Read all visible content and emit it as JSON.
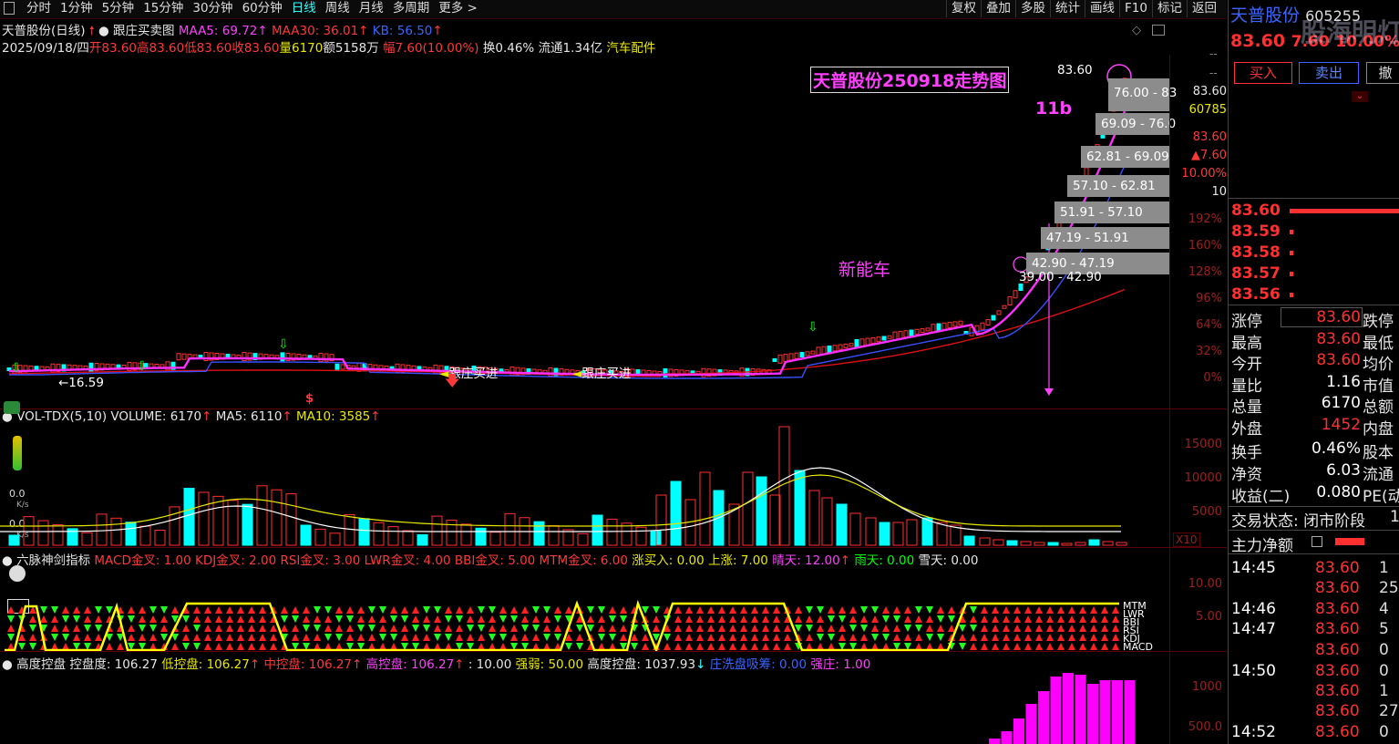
{
  "toolbar": {
    "tabs": [
      "分时",
      "1分钟",
      "5分钟",
      "15分钟",
      "30分钟",
      "60分钟",
      "日线",
      "周线",
      "月线",
      "多周期",
      "更多 >"
    ],
    "tools": [
      "复权",
      "叠加",
      "多股",
      "统计",
      "画线",
      "F10",
      "标记",
      "返回"
    ]
  },
  "header": {
    "name_line": "天普股份(日线)",
    "indicator": "跟庄买卖图",
    "maa5": "MAA5: 69.72",
    "maa30": "MAA30: 36.01",
    "kb": "KB: 56.50",
    "date": "2025/09/18/四",
    "open": "开83.60",
    "high": "高83.60",
    "low": "低83.60",
    "close": "收83.60",
    "vol": "量6170",
    "amount": "额5158万",
    "change": "幅7.60(10.00%)",
    "turnover": "换0.46%",
    "float": "流通1.34亿",
    "sector": "汽车配件"
  },
  "chart": {
    "title_box": "天普股份250918走势图",
    "label_11b": "11b",
    "label_xny": "新能车",
    "last_price_tag": "83.60",
    "low_tag": "←16.59",
    "signal_buy": "跟庄买进",
    "dollar_mark": "$",
    "right_axis": [
      "83.60",
      "60785",
      "83.60",
      "▲7.60",
      "10.00%",
      "10"
    ],
    "pct_axis": [
      "192%",
      "160%",
      "128%",
      "96%",
      "64%",
      "32%",
      "0%"
    ],
    "dashes": [
      "--",
      "--"
    ],
    "ladder": [
      "76.00 - 83",
      "69.09 - 76.0",
      "62.81 - 69.09",
      "57.10 - 62.81",
      "51.91 - 57.10",
      "47.19 - 51.91",
      "42.90 - 47.19",
      "39.00 - 42.90"
    ]
  },
  "volume_panel": {
    "title": "VOL-TDX(5,10) VOLUME: 6170",
    "ma5": "MA5: 6110",
    "ma10": "MA10: 3585",
    "axis": [
      "15000",
      "10000",
      "5000"
    ],
    "x10": "X10",
    "side_vals": [
      "0.0",
      "K/s",
      "0.0",
      "K/s"
    ]
  },
  "sword_panel": {
    "title": "六脉神剑指标",
    "macd": "MACD金叉: 1.00",
    "kdj": "KDJ金叉: 2.00",
    "rsi": "RSI金叉: 3.00",
    "lwr": "LWR金叉: 4.00",
    "bbi": "BBI金叉: 5.00",
    "mtm": "MTM金叉: 6.00",
    "zmr": "涨买入: 0.00",
    "up": "上涨: 7.00",
    "sunny": "晴天: 12.00",
    "rainy": "雨天: 0.00",
    "snow": "雪天: 0.00",
    "axis": [
      "10.00",
      "5.00"
    ],
    "legend": [
      "MTM",
      "LWR",
      "BBI",
      "RSI",
      "KDJ",
      "MACD"
    ]
  },
  "control_panel": {
    "title": "高度控盘",
    "kpd": "控盘度: 106.27",
    "low": "低控盘: 106.27",
    "mid": "中控盘: 106.27",
    "high": "高控盘: 106.27",
    "ten": ": 10.00",
    "strong": "强弱: 50.00",
    "hc": "高度控盘: 1037.93",
    "xp": "庄洗盘吸筹: 0.00",
    "qz": "强庄: 1.00",
    "axis": [
      "1000",
      "500.0"
    ]
  },
  "quote": {
    "name": "天普股份",
    "code": "605255",
    "price": "83.60",
    "chg": "7.60",
    "pct": "10.00%",
    "watermark": "股海明灯",
    "buy_btn": "买入",
    "sell_btn": "卖出",
    "cancel_btn": "撤",
    "asks": [
      {
        "p": "83.60"
      },
      {
        "p": "83.59"
      },
      {
        "p": "83.58"
      },
      {
        "p": "83.57"
      },
      {
        "p": "83.56"
      }
    ],
    "stats": [
      {
        "k": "涨停",
        "v": "83.60",
        "t": "跌停"
      },
      {
        "k": "最高",
        "v": "83.60",
        "t": "最低"
      },
      {
        "k": "今开",
        "v": "83.60",
        "t": "均价"
      },
      {
        "k": "量比",
        "v": "1.16",
        "t": "市值"
      },
      {
        "k": "总量",
        "v": "6170",
        "t": "总额"
      },
      {
        "k": "外盘",
        "v": "1452",
        "t": "内盘"
      },
      {
        "k": "换手",
        "v": "0.46%",
        "t": "股本"
      },
      {
        "k": "净资",
        "v": "6.03",
        "t": "流通"
      },
      {
        "k": "收益(二)",
        "v": "0.080",
        "t": "PE(动"
      }
    ],
    "status": "交易状态: 闭市阶段",
    "status_n": "1",
    "main_flow": "主力净额",
    "ticks": [
      {
        "time": "14:45",
        "price": "83.60",
        "vol": "1"
      },
      {
        "time": "",
        "price": "83.60",
        "vol": "25"
      },
      {
        "time": "14:46",
        "price": "83.60",
        "vol": "4"
      },
      {
        "time": "14:47",
        "price": "83.60",
        "vol": "5"
      },
      {
        "time": "",
        "price": "83.60",
        "vol": "0"
      },
      {
        "time": "14:50",
        "price": "83.60",
        "vol": "0"
      },
      {
        "time": "",
        "price": "83.60",
        "vol": "1"
      },
      {
        "time": "",
        "price": "83.60",
        "vol": "27"
      },
      {
        "time": "14:52",
        "price": "83.60",
        "vol": "0"
      }
    ]
  },
  "colors": {
    "up": "#ff3030",
    "down": "#00ffff",
    "ma_mag": "#ff30ff",
    "ma_blue": "#3a50ff",
    "ma_red": "#e01010",
    "yellow": "#ffff00"
  }
}
